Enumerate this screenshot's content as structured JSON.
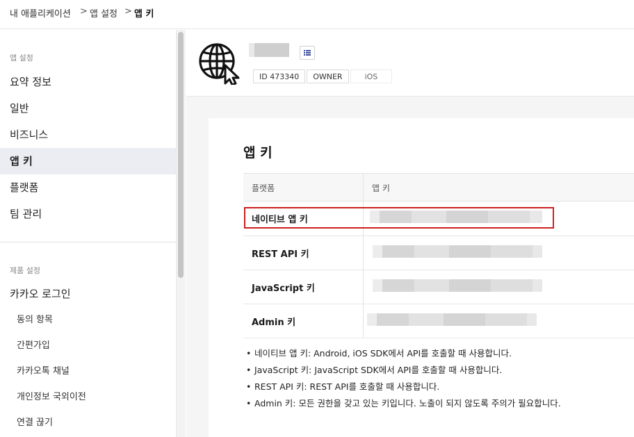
{
  "breadcrumb": {
    "items": [
      "내 애플리케이션",
      "앱 설정",
      "앱 키"
    ],
    "separator": ">"
  },
  "sidebar": {
    "section_app": "앱 설정",
    "items": [
      "요약 정보",
      "일반",
      "비즈니스",
      "앱 키",
      "플랫폼",
      "팀 관리"
    ],
    "active": "앱 키",
    "section_product": "제품 설정",
    "product_title": "카카오 로그인",
    "sub_items": [
      "동의 항목",
      "간편가입",
      "카카오톡 채널",
      "개인정보 국외이전",
      "연결 끊기"
    ]
  },
  "app": {
    "icon": "globe-cursor-icon",
    "tags": [
      "ID 473340",
      "OWNER",
      "iOS"
    ]
  },
  "keys": {
    "title": "앱 키",
    "headers": [
      "플랫폼",
      "앱 키"
    ],
    "rows": [
      "네이티브 앱 키",
      "REST API 키",
      "JavaScript 키",
      "Admin 키"
    ],
    "highlighted_row": "네이티브 앱 키"
  },
  "notes": [
    "네이티브 앱 키: Android, iOS SDK에서 API를 호출할 때 사용합니다.",
    "JavaScript 키: JavaScript SDK에서 API를 호출할 때 사용합니다.",
    "REST API 키: REST API를 호출할 때 사용합니다.",
    "Admin 키: 모든 권한을 갖고 있는 키입니다. 노출이 되지 않도록 주의가 필요합니다."
  ],
  "colors": {
    "highlight_border": "#cc1f1f",
    "active_item_bg": "#ecedf2"
  }
}
